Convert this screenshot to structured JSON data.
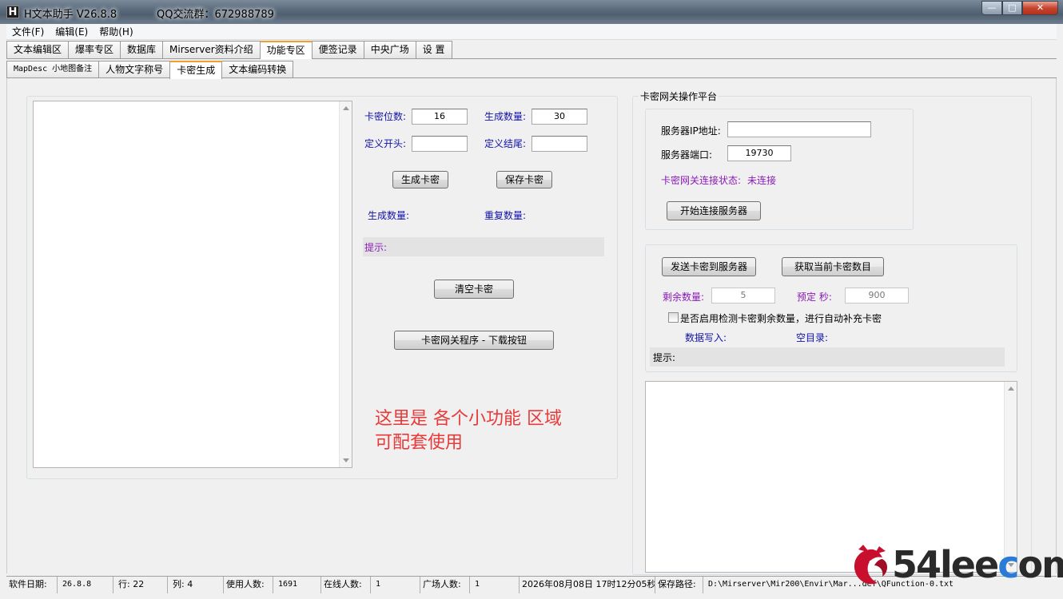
{
  "window": {
    "app_icon": "H",
    "title": "H文本助手  V26.8.8",
    "qq_group": "QQ交流群：672988789",
    "controls": {
      "minimize": "—",
      "maximize": "□",
      "close": "✕"
    }
  },
  "menu": [
    "文件(F)",
    "编辑(E)",
    "帮助(H)"
  ],
  "tabs_main": [
    "文本编辑区",
    "爆率专区",
    "数据库",
    "Mirserver资料介绍",
    "功能专区",
    "便签记录",
    "中央广场",
    "设  置"
  ],
  "tabs_main_active": "功能专区",
  "tabs_sub": [
    "MapDesc 小地图备注",
    "人物文字称号",
    "卡密生成",
    "文本编码转换"
  ],
  "tabs_sub_active": "卡密生成",
  "card_gen": {
    "digits_label": "卡密位数:",
    "digits_value": "16",
    "count_label": "生成数量:",
    "count_value": "30",
    "prefix_label": "定义开头:",
    "prefix_value": "",
    "suffix_label": "定义结尾:",
    "suffix_value": "",
    "generate_btn": "生成卡密",
    "save_btn": "保存卡密",
    "generated_label": "生成数量:",
    "duplicate_label": "重复数量:",
    "hint_label": "提示:",
    "clear_btn": "清空卡密",
    "download_btn": "卡密网关程序 - 下载按钮",
    "note_line1": "这里是  各个小功能 区域",
    "note_line2": "可配套使用"
  },
  "gateway": {
    "group_title": "卡密网关操作平台",
    "ip_label": "服务器IP地址:",
    "ip_value": "",
    "port_label": "服务器端口:",
    "port_value": "19730",
    "status_label": "卡密网关连接状态:",
    "status_value": "未连接",
    "connect_btn": "开始连接服务器",
    "send_btn": "发送卡密到服务器",
    "fetch_btn": "获取当前卡密数目",
    "remain_label": "剩余数量:",
    "remain_value": "5",
    "preset_label": "预定 秒:",
    "preset_value": "900",
    "auto_check_label": "是否启用检测卡密剩余数量，进行自动补充卡密",
    "data_write_label": "数据写入:",
    "empty_dir_label": "空目录:",
    "hint_label": "提示:"
  },
  "statusbar": {
    "date_label": "软件日期:",
    "date_value": "26.8.8",
    "row_label": "行: 22",
    "col_label": "列: 4",
    "users_label": "使用人数:",
    "users_value": "1691",
    "online_label": "在线人数:",
    "online_value": "1",
    "plaza_label": "广场人数:",
    "plaza_value": "1",
    "datetime": "2026年08月08日 17时12分05秒",
    "save_path_label": "保存路径:",
    "save_path_value": "D:\\Mirserver\\Mir200\\Envir\\Mar...def\\QFunction-0.txt"
  },
  "watermark": {
    "prefix": "54lee",
    "accent": "c",
    "suffix": "om"
  }
}
